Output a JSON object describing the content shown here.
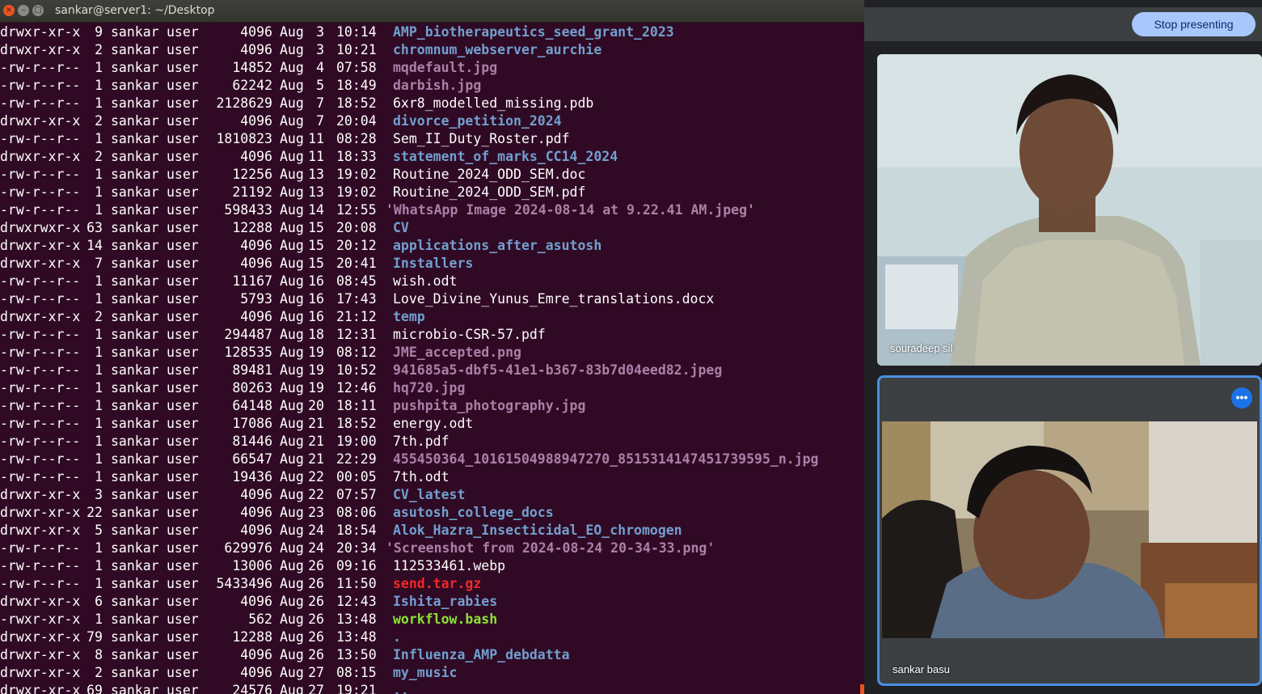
{
  "terminal": {
    "title": "sankar@server1: ~/Desktop",
    "buttons": {
      "close": "×",
      "minimize": "–",
      "maximize": "□"
    },
    "colors": {
      "background": "#300a24",
      "directory": "#729fcf",
      "image": "#ad7fa8",
      "archive": "#ef2929",
      "executable": "#8ae234"
    },
    "listing": [
      {
        "perm": "drwxr-xr-x",
        "links": "9",
        "owner": "sankar",
        "group": "user",
        "size": "4096",
        "month": "Aug",
        "day": "3",
        "time": "10:14",
        "name": "AMP_biotherapeutics_seed_grant_2023",
        "kind": "dir"
      },
      {
        "perm": "drwxr-xr-x",
        "links": "2",
        "owner": "sankar",
        "group": "user",
        "size": "4096",
        "month": "Aug",
        "day": "3",
        "time": "10:21",
        "name": "chromnum_webserver_aurchie",
        "kind": "dir"
      },
      {
        "perm": "-rw-r--r--",
        "links": "1",
        "owner": "sankar",
        "group": "user",
        "size": "14852",
        "month": "Aug",
        "day": "4",
        "time": "07:58",
        "name": "mqdefault.jpg",
        "kind": "img"
      },
      {
        "perm": "-rw-r--r--",
        "links": "1",
        "owner": "sankar",
        "group": "user",
        "size": "62242",
        "month": "Aug",
        "day": "5",
        "time": "18:49",
        "name": "darbish.jpg",
        "kind": "img"
      },
      {
        "perm": "-rw-r--r--",
        "links": "1",
        "owner": "sankar",
        "group": "user",
        "size": "2128629",
        "month": "Aug",
        "day": "7",
        "time": "18:52",
        "name": "6xr8_modelled_missing.pdb",
        "kind": "file"
      },
      {
        "perm": "drwxr-xr-x",
        "links": "2",
        "owner": "sankar",
        "group": "user",
        "size": "4096",
        "month": "Aug",
        "day": "7",
        "time": "20:04",
        "name": "divorce_petition_2024",
        "kind": "dir"
      },
      {
        "perm": "-rw-r--r--",
        "links": "1",
        "owner": "sankar",
        "group": "user",
        "size": "1810823",
        "month": "Aug",
        "day": "11",
        "time": "08:28",
        "name": "Sem_II_Duty_Roster.pdf",
        "kind": "file"
      },
      {
        "perm": "drwxr-xr-x",
        "links": "2",
        "owner": "sankar",
        "group": "user",
        "size": "4096",
        "month": "Aug",
        "day": "11",
        "time": "18:33",
        "name": "statement_of_marks_CC14_2024",
        "kind": "dir"
      },
      {
        "perm": "-rw-r--r--",
        "links": "1",
        "owner": "sankar",
        "group": "user",
        "size": "12256",
        "month": "Aug",
        "day": "13",
        "time": "19:02",
        "name": "Routine_2024_ODD_SEM.doc",
        "kind": "file"
      },
      {
        "perm": "-rw-r--r--",
        "links": "1",
        "owner": "sankar",
        "group": "user",
        "size": "21192",
        "month": "Aug",
        "day": "13",
        "time": "19:02",
        "name": "Routine_2024_ODD_SEM.pdf",
        "kind": "file"
      },
      {
        "perm": "-rw-r--r--",
        "links": "1",
        "owner": "sankar",
        "group": "user",
        "size": "598433",
        "month": "Aug",
        "day": "14",
        "time": "12:55",
        "name": "'WhatsApp Image 2024-08-14 at 9.22.41 AM.jpeg'",
        "kind": "img",
        "quoted": true
      },
      {
        "perm": "drwxrwxr-x",
        "links": "63",
        "owner": "sankar",
        "group": "user",
        "size": "12288",
        "month": "Aug",
        "day": "15",
        "time": "20:08",
        "name": "CV",
        "kind": "dir"
      },
      {
        "perm": "drwxr-xr-x",
        "links": "14",
        "owner": "sankar",
        "group": "user",
        "size": "4096",
        "month": "Aug",
        "day": "15",
        "time": "20:12",
        "name": "applications_after_asutosh",
        "kind": "dir"
      },
      {
        "perm": "drwxr-xr-x",
        "links": "7",
        "owner": "sankar",
        "group": "user",
        "size": "4096",
        "month": "Aug",
        "day": "15",
        "time": "20:41",
        "name": "Installers",
        "kind": "dir"
      },
      {
        "perm": "-rw-r--r--",
        "links": "1",
        "owner": "sankar",
        "group": "user",
        "size": "11167",
        "month": "Aug",
        "day": "16",
        "time": "08:45",
        "name": "wish.odt",
        "kind": "file"
      },
      {
        "perm": "-rw-r--r--",
        "links": "1",
        "owner": "sankar",
        "group": "user",
        "size": "5793",
        "month": "Aug",
        "day": "16",
        "time": "17:43",
        "name": "Love_Divine_Yunus_Emre_translations.docx",
        "kind": "file"
      },
      {
        "perm": "drwxr-xr-x",
        "links": "2",
        "owner": "sankar",
        "group": "user",
        "size": "4096",
        "month": "Aug",
        "day": "16",
        "time": "21:12",
        "name": "temp",
        "kind": "dir"
      },
      {
        "perm": "-rw-r--r--",
        "links": "1",
        "owner": "sankar",
        "group": "user",
        "size": "294487",
        "month": "Aug",
        "day": "18",
        "time": "12:31",
        "name": "microbio-CSR-57.pdf",
        "kind": "file"
      },
      {
        "perm": "-rw-r--r--",
        "links": "1",
        "owner": "sankar",
        "group": "user",
        "size": "128535",
        "month": "Aug",
        "day": "19",
        "time": "08:12",
        "name": "JME_accepted.png",
        "kind": "img"
      },
      {
        "perm": "-rw-r--r--",
        "links": "1",
        "owner": "sankar",
        "group": "user",
        "size": "89481",
        "month": "Aug",
        "day": "19",
        "time": "10:52",
        "name": "941685a5-dbf5-41e1-b367-83b7d04eed82.jpeg",
        "kind": "img"
      },
      {
        "perm": "-rw-r--r--",
        "links": "1",
        "owner": "sankar",
        "group": "user",
        "size": "80263",
        "month": "Aug",
        "day": "19",
        "time": "12:46",
        "name": "hq720.jpg",
        "kind": "img"
      },
      {
        "perm": "-rw-r--r--",
        "links": "1",
        "owner": "sankar",
        "group": "user",
        "size": "64148",
        "month": "Aug",
        "day": "20",
        "time": "18:11",
        "name": "pushpita_photography.jpg",
        "kind": "img"
      },
      {
        "perm": "-rw-r--r--",
        "links": "1",
        "owner": "sankar",
        "group": "user",
        "size": "17086",
        "month": "Aug",
        "day": "21",
        "time": "18:52",
        "name": "energy.odt",
        "kind": "file"
      },
      {
        "perm": "-rw-r--r--",
        "links": "1",
        "owner": "sankar",
        "group": "user",
        "size": "81446",
        "month": "Aug",
        "day": "21",
        "time": "19:00",
        "name": "7th.pdf",
        "kind": "file"
      },
      {
        "perm": "-rw-r--r--",
        "links": "1",
        "owner": "sankar",
        "group": "user",
        "size": "66547",
        "month": "Aug",
        "day": "21",
        "time": "22:29",
        "name": "455450364_10161504988947270_8515314147451739595_n.jpg",
        "kind": "img"
      },
      {
        "perm": "-rw-r--r--",
        "links": "1",
        "owner": "sankar",
        "group": "user",
        "size": "19436",
        "month": "Aug",
        "day": "22",
        "time": "00:05",
        "name": "7th.odt",
        "kind": "file"
      },
      {
        "perm": "drwxr-xr-x",
        "links": "3",
        "owner": "sankar",
        "group": "user",
        "size": "4096",
        "month": "Aug",
        "day": "22",
        "time": "07:57",
        "name": "CV_latest",
        "kind": "dir"
      },
      {
        "perm": "drwxr-xr-x",
        "links": "22",
        "owner": "sankar",
        "group": "user",
        "size": "4096",
        "month": "Aug",
        "day": "23",
        "time": "08:06",
        "name": "asutosh_college_docs",
        "kind": "dir"
      },
      {
        "perm": "drwxr-xr-x",
        "links": "5",
        "owner": "sankar",
        "group": "user",
        "size": "4096",
        "month": "Aug",
        "day": "24",
        "time": "18:54",
        "name": "Alok_Hazra_Insecticidal_EO_chromogen",
        "kind": "dir"
      },
      {
        "perm": "-rw-r--r--",
        "links": "1",
        "owner": "sankar",
        "group": "user",
        "size": "629976",
        "month": "Aug",
        "day": "24",
        "time": "20:34",
        "name": "'Screenshot from 2024-08-24 20-34-33.png'",
        "kind": "img",
        "quoted": true
      },
      {
        "perm": "-rw-r--r--",
        "links": "1",
        "owner": "sankar",
        "group": "user",
        "size": "13006",
        "month": "Aug",
        "day": "26",
        "time": "09:16",
        "name": "112533461.webp",
        "kind": "file"
      },
      {
        "perm": "-rw-r--r--",
        "links": "1",
        "owner": "sankar",
        "group": "user",
        "size": "5433496",
        "month": "Aug",
        "day": "26",
        "time": "11:50",
        "name": "send.tar.gz",
        "kind": "arch"
      },
      {
        "perm": "drwxr-xr-x",
        "links": "6",
        "owner": "sankar",
        "group": "user",
        "size": "4096",
        "month": "Aug",
        "day": "26",
        "time": "12:43",
        "name": "Ishita_rabies",
        "kind": "dir"
      },
      {
        "perm": "-rwxr-xr-x",
        "links": "1",
        "owner": "sankar",
        "group": "user",
        "size": "562",
        "month": "Aug",
        "day": "26",
        "time": "13:48",
        "name": "workflow.bash",
        "kind": "exec"
      },
      {
        "perm": "drwxr-xr-x",
        "links": "79",
        "owner": "sankar",
        "group": "user",
        "size": "12288",
        "month": "Aug",
        "day": "26",
        "time": "13:48",
        "name": ".",
        "kind": "dir"
      },
      {
        "perm": "drwxr-xr-x",
        "links": "8",
        "owner": "sankar",
        "group": "user",
        "size": "4096",
        "month": "Aug",
        "day": "26",
        "time": "13:50",
        "name": "Influenza_AMP_debdatta",
        "kind": "dir"
      },
      {
        "perm": "drwxr-xr-x",
        "links": "2",
        "owner": "sankar",
        "group": "user",
        "size": "4096",
        "month": "Aug",
        "day": "27",
        "time": "08:15",
        "name": "my_music",
        "kind": "dir"
      },
      {
        "perm": "drwxr-xr-x",
        "links": "69",
        "owner": "sankar",
        "group": "user",
        "size": "24576",
        "month": "Aug",
        "day": "27",
        "time": "19:21",
        "name": "..",
        "kind": "dir"
      }
    ]
  },
  "meeting": {
    "stop_presenting_label": "Stop presenting",
    "accent_color": "#a8c7fa",
    "participants": [
      {
        "name": "souradeep sil"
      },
      {
        "name": "sankar basu"
      }
    ],
    "more_options_icon": "more-horizontal-icon"
  }
}
